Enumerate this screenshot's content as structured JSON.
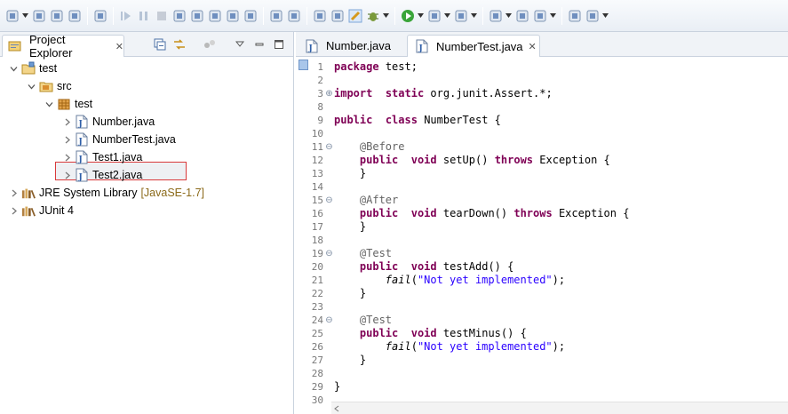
{
  "toolbar": {
    "icons": [
      "new-icon",
      "save-icon",
      "save-all-icon",
      "print-icon",
      "skip-breakpoints-icon",
      "resume-icon",
      "suspend-icon",
      "terminate-icon",
      "disconnect-icon",
      "step-into-icon",
      "step-over-icon",
      "step-return-icon",
      "drop-to-frame-icon",
      "use-step-filters-icon",
      "new-java-project-icon",
      "new-package-icon",
      "open-type-icon",
      "toggle-highlight-icon",
      "debug-icon",
      "run-icon",
      "external-tools-icon",
      "new-class-icon",
      "new-interface-icon",
      "open-folder-icon",
      "search-icon",
      "globe-icon",
      "next-annotation-icon"
    ]
  },
  "left_panel": {
    "tab_label": "Project Explorer",
    "close_glyph": "✕",
    "tree": [
      {
        "label": "test",
        "level": 0,
        "expanded": true,
        "icon": "project-icon"
      },
      {
        "label": "src",
        "level": 1,
        "expanded": true,
        "icon": "source-folder-icon"
      },
      {
        "label": "test",
        "level": 2,
        "expanded": true,
        "icon": "package-icon"
      },
      {
        "label": "Number.java",
        "level": 3,
        "expanded": false,
        "icon": "java-file-icon"
      },
      {
        "label": "NumberTest.java",
        "level": 3,
        "expanded": false,
        "icon": "java-file-icon",
        "selected": true
      },
      {
        "label": "Test1.java",
        "level": 3,
        "expanded": false,
        "icon": "java-file-icon"
      },
      {
        "label": "Test2.java",
        "level": 3,
        "expanded": false,
        "icon": "java-file-icon"
      },
      {
        "label": "JRE System Library",
        "decoration": "[JavaSE-1.7]",
        "level": 0,
        "expanded": false,
        "icon": "library-icon"
      },
      {
        "label": "JUnit 4",
        "level": 0,
        "expanded": false,
        "icon": "library-icon"
      }
    ]
  },
  "editor": {
    "tabs": [
      {
        "label": "Number.java",
        "active": false
      },
      {
        "label": "NumberTest.java",
        "active": true,
        "close_glyph": "✕"
      }
    ],
    "lines": [
      {
        "n": "1",
        "fold": "",
        "parts": [
          [
            "kw",
            "package"
          ],
          [
            "",
            "test;"
          ]
        ]
      },
      {
        "n": "2",
        "fold": "",
        "parts": []
      },
      {
        "n": "3",
        "fold": "⊕",
        "parts": [
          [
            "kw",
            "import"
          ],
          [
            "",
            ""
          ],
          [
            "kw",
            "static"
          ],
          [
            "",
            "org.junit.Assert.*;"
          ]
        ]
      },
      {
        "n": "8",
        "fold": "",
        "parts": []
      },
      {
        "n": "9",
        "fold": "",
        "parts": [
          [
            "kw",
            "public"
          ],
          [
            "",
            ""
          ],
          [
            "kw",
            "class"
          ],
          [
            "",
            "NumberTest {"
          ]
        ]
      },
      {
        "n": "10",
        "fold": "",
        "parts": []
      },
      {
        "n": "11",
        "fold": "⊖",
        "parts": [
          [
            "ind",
            "    "
          ],
          [
            "ann",
            "@Before"
          ]
        ]
      },
      {
        "n": "12",
        "fold": "",
        "parts": [
          [
            "ind",
            "    "
          ],
          [
            "kw",
            "public"
          ],
          [
            "",
            ""
          ],
          [
            "kw",
            "void"
          ],
          [
            "",
            "setUp()"
          ],
          [
            "kw",
            "throws"
          ],
          [
            "",
            "Exception {"
          ]
        ]
      },
      {
        "n": "13",
        "fold": "",
        "parts": [
          [
            "ind",
            "    "
          ],
          [
            "",
            "}"
          ]
        ]
      },
      {
        "n": "14",
        "fold": "",
        "parts": []
      },
      {
        "n": "15",
        "fold": "⊖",
        "parts": [
          [
            "ind",
            "    "
          ],
          [
            "ann",
            "@After"
          ]
        ]
      },
      {
        "n": "16",
        "fold": "",
        "parts": [
          [
            "ind",
            "    "
          ],
          [
            "kw",
            "public"
          ],
          [
            "",
            ""
          ],
          [
            "kw",
            "void"
          ],
          [
            "",
            "tearDown()"
          ],
          [
            "kw",
            "throws"
          ],
          [
            "",
            "Exception {"
          ]
        ]
      },
      {
        "n": "17",
        "fold": "",
        "parts": [
          [
            "ind",
            "    "
          ],
          [
            "",
            "}"
          ]
        ]
      },
      {
        "n": "18",
        "fold": "",
        "parts": []
      },
      {
        "n": "19",
        "fold": "⊖",
        "parts": [
          [
            "ind",
            "    "
          ],
          [
            "ann",
            "@Test"
          ]
        ]
      },
      {
        "n": "20",
        "fold": "",
        "parts": [
          [
            "ind",
            "    "
          ],
          [
            "kw",
            "public"
          ],
          [
            "",
            ""
          ],
          [
            "kw",
            "void"
          ],
          [
            "",
            "testAdd() {"
          ]
        ]
      },
      {
        "n": "21",
        "fold": "",
        "parts": [
          [
            "ind",
            "        "
          ],
          [
            "ital",
            "fail"
          ],
          [
            "p",
            "("
          ],
          [
            "str",
            "\"Not yet implemented\""
          ],
          [
            "p",
            ");"
          ]
        ]
      },
      {
        "n": "22",
        "fold": "",
        "parts": [
          [
            "ind",
            "    "
          ],
          [
            "",
            "}"
          ]
        ]
      },
      {
        "n": "23",
        "fold": "",
        "parts": []
      },
      {
        "n": "24",
        "fold": "⊖",
        "parts": [
          [
            "ind",
            "    "
          ],
          [
            "ann",
            "@Test"
          ]
        ]
      },
      {
        "n": "25",
        "fold": "",
        "parts": [
          [
            "ind",
            "    "
          ],
          [
            "kw",
            "public"
          ],
          [
            "",
            ""
          ],
          [
            "kw",
            "void"
          ],
          [
            "",
            "testMinus() {"
          ]
        ]
      },
      {
        "n": "26",
        "fold": "",
        "parts": [
          [
            "ind",
            "        "
          ],
          [
            "ital",
            "fail"
          ],
          [
            "p",
            "("
          ],
          [
            "str",
            "\"Not yet implemented\""
          ],
          [
            "p",
            ");"
          ]
        ]
      },
      {
        "n": "27",
        "fold": "",
        "parts": [
          [
            "ind",
            "    "
          ],
          [
            "",
            "}"
          ]
        ]
      },
      {
        "n": "28",
        "fold": "",
        "parts": []
      },
      {
        "n": "29",
        "fold": "",
        "parts": [
          [
            "",
            "}"
          ]
        ]
      },
      {
        "n": "30",
        "fold": "",
        "parts": []
      }
    ]
  },
  "colors": {
    "keyword": "#7f0055",
    "annotation": "#646464",
    "string": "#2a00ff",
    "selection_border": "#d9393a"
  }
}
